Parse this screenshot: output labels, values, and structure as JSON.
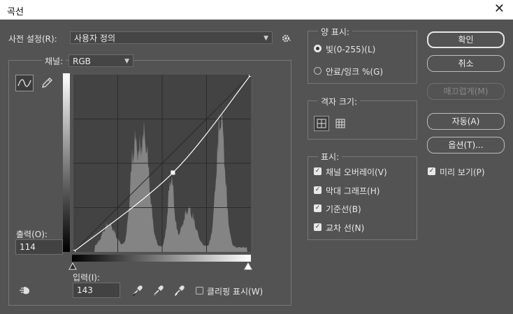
{
  "window": {
    "title": "곡선",
    "close_glyph": "✕"
  },
  "preset": {
    "label": "사전 설정(R):",
    "value": "사용자 정의",
    "options_icon": "gear-icon"
  },
  "channel": {
    "label": "채널:",
    "value": "RGB"
  },
  "output": {
    "label": "출력(O):",
    "value": "114"
  },
  "input": {
    "label": "입력(I):",
    "value": "143"
  },
  "tools": {
    "curve_tool": "curve-edit-icon",
    "pencil_tool": "pencil-icon",
    "on_image_adjust": "hand-adjust-icon"
  },
  "eyedroppers": [
    "black-point-eyedropper-icon",
    "gray-point-eyedropper-icon",
    "white-point-eyedropper-icon"
  ],
  "clipping": {
    "label": "클리핑 표시(W)",
    "checked": false
  },
  "display_amount": {
    "title": "양 표시:",
    "options": [
      {
        "label": "빛(0-255)(L)",
        "selected": true
      },
      {
        "label": "안료/잉크 %(G)",
        "selected": false
      }
    ]
  },
  "grid_size": {
    "title": "격자 크기:",
    "simple_icon": "grid-4x4-icon",
    "detailed_icon": "grid-10x10-icon"
  },
  "show": {
    "title": "표시:",
    "options": [
      {
        "label": "채널 오버레이(V)",
        "checked": true
      },
      {
        "label": "막대 그래프(H)",
        "checked": true
      },
      {
        "label": "기준선(B)",
        "checked": true
      },
      {
        "label": "교차 선(N)",
        "checked": true
      }
    ]
  },
  "buttons": {
    "ok": "확인",
    "cancel": "취소",
    "smooth": "매끄럽게(M)",
    "auto": "자동(A)",
    "options": "옵션(T)..."
  },
  "preview": {
    "label": "미리 보기(P)",
    "checked": true
  },
  "curve": {
    "points": [
      [
        0,
        0
      ],
      [
        143,
        114
      ],
      [
        255,
        255
      ]
    ],
    "selected_point": [
      143,
      114
    ]
  },
  "colors": {
    "background": "#535353",
    "graph_bg": "#434343",
    "histogram": "#9a9a9a",
    "curve": "#ffffff"
  }
}
